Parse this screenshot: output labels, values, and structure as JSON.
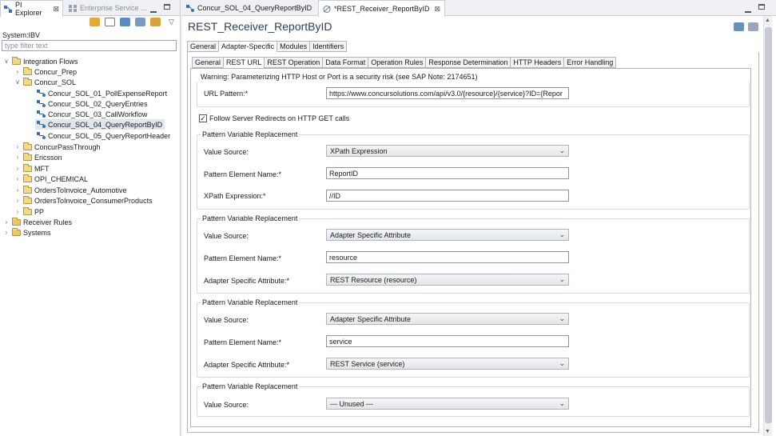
{
  "left_pane": {
    "tabs": [
      {
        "label": "PI Explorer",
        "icon": "pi-explorer-icon"
      },
      {
        "label": "Enterprise Service ...",
        "icon": "enterprise-service-icon"
      }
    ],
    "system_label": "System:IBV",
    "filter_placeholder": "type filter text",
    "tree": {
      "integration_flows": "Integration Flows",
      "concur_prep": "Concur_Prep",
      "concur_sol": "Concur_SOL",
      "flow1": "Concur_SOL_01_PollExpenseReport",
      "flow2": "Concur_SOL_02_QueryEntries",
      "flow3": "Concur_SOL_03_CallWorkflow",
      "flow4": "Concur_SOL_04_QueryReportByID",
      "flow5": "Concur_SOL_05_QueryReportHeader",
      "f_passthrough": "ConcurPassThrough",
      "f_ericsson": "Ericsson",
      "f_mft": "MFT",
      "f_opi": "OPI_CHEMICAL",
      "f_orders_auto": "OrdersToInvoice_Automotive",
      "f_orders_cp": "OrdersToInvoice_ConsumerProducts",
      "f_pp": "PP",
      "receiver_rules": "Receiver Rules",
      "systems": "Systems"
    }
  },
  "editor": {
    "tabs": [
      {
        "label": "Concur_SOL_04_QueryReportByID"
      },
      {
        "label": "*REST_Receiver_ReportByID"
      }
    ],
    "title": "REST_Receiver_ReportByID",
    "main_tabs": [
      "General",
      "Adapter-Specific",
      "Modules",
      "Identifiers"
    ],
    "sub_tabs": [
      "General",
      "REST URL",
      "REST Operation",
      "Data Format",
      "Operation Rules",
      "Response Determination",
      "HTTP Headers",
      "Error Handling"
    ],
    "warning": "Warning: Parameterizing HTTP Host or Port is a security risk (see SAP Note: 2174651)",
    "url_pattern_label": "URL Pattern:*",
    "url_pattern_value": "https://www.concursolutions.com/api/v3.0/{resource}/{service}?ID={Repor",
    "follow_redirects_label": "Follow Server Redirects on HTTP GET calls",
    "group_title": "Pattern Variable Replacement",
    "lbl_value_source": "Value Source:",
    "lbl_pattern_element": "Pattern Element Name:*",
    "lbl_xpath": "XPath Expression:*",
    "lbl_adapter_attr": "Adapter Specific Attribute:*",
    "g1": {
      "value_source": "XPath Expression",
      "element": "ReportID",
      "xpath": "//ID"
    },
    "g2": {
      "value_source": "Adapter Specific Attribute",
      "element": "resource",
      "attr": "REST Resource (resource)"
    },
    "g3": {
      "value_source": "Adapter Specific Attribute",
      "element": "service",
      "attr": "REST Service (service)"
    },
    "g4": {
      "value_source": "--- Unused ---"
    }
  }
}
